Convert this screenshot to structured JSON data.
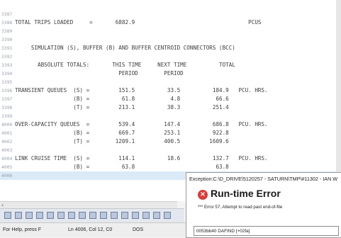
{
  "editor": {
    "lines": [
      {
        "ln": "3387",
        "text": ""
      },
      {
        "ln": "3388",
        "text": "TOTAL TRIPS LOADED     =       6882.9                                   PCUS"
      },
      {
        "ln": "3389",
        "text": ""
      },
      {
        "ln": "3390",
        "text": ""
      },
      {
        "ln": "3391",
        "text": "     SIMULATION (S), BUFFER (B) AND BUFFER CENTROID CONNECTORS (BCC)"
      },
      {
        "ln": "3392",
        "text": ""
      },
      {
        "ln": "3393",
        "text": "       ABSOLUTE TOTALS:       THIS TIME     NEXT TIME          TOTAL"
      },
      {
        "ln": "3394",
        "text": "                                PERIOD        PERIOD"
      },
      {
        "ln": "3395",
        "text": ""
      },
      {
        "ln": "3396",
        "text": "TRANSIENT QUEUES  (S) =         151.5          33.5          184.9   PCU. HRS."
      },
      {
        "ln": "3397",
        "text": "                  (B) =          61.8           4.8           66.6"
      },
      {
        "ln": "3398",
        "text": "                  (T) =         213.1          38.3          251.4"
      },
      {
        "ln": "3399",
        "text": ""
      },
      {
        "ln": "4000",
        "text": "OVER-CAPACITY QUEUES  =         539.4         147.4          686.8   PCU. HRS."
      },
      {
        "ln": "4001",
        "text": "                  (B) =         669.7         253.1          922.8"
      },
      {
        "ln": "4002",
        "text": "                  (T) =        1209.1         400.5         1609.6"
      },
      {
        "ln": "4003",
        "text": ""
      },
      {
        "ln": "4004",
        "text": "LINK CRUISE TIME  (S) =         114.1          18.6          132.7   PCU. HRS."
      },
      {
        "ln": "4005",
        "text": "                  (B) =          63.8                         63.8"
      },
      {
        "ln": "4006",
        "text": ""
      }
    ]
  },
  "status": {
    "help": "For Help, press F",
    "position": "Ln 4006, Col 12, C0",
    "mode": "DOS"
  },
  "dialog": {
    "title": "Exception:C:\\D_DRIVE\\5120257 - SATURN\\TMP\\#11302 - IAN W",
    "heading": "Run-time Error",
    "message": "*** Error  57, Attempt to read past end-of-file",
    "trace": "0053bb40 DAFIND [+02fa]",
    "icon": "error-icon",
    "icon_color": "#d83b3b"
  },
  "toolbar": {
    "icons": [
      "paste-icon",
      "align-left-icon",
      "align-center-icon",
      "align-right-icon",
      "list-icon",
      "indent-icon",
      "outdent-icon",
      "bookmark-icon",
      "font-icon",
      "format-icon",
      "tab-icon",
      "tab-icon",
      "tab-icon",
      "bookmark-icon",
      "toggle-icon",
      "toggle-icon"
    ]
  },
  "colors": {
    "highlight_line": "#daeaf7",
    "line_number": "#9aa3ae"
  }
}
